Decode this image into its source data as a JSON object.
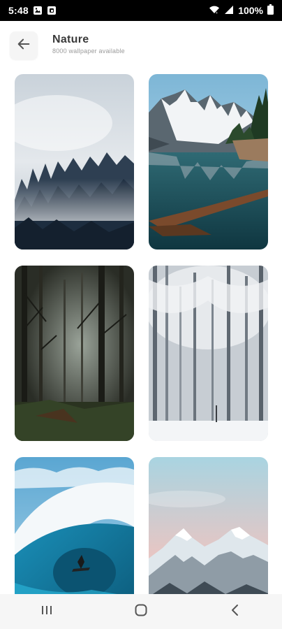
{
  "status_bar": {
    "time": "5:48",
    "battery": "100%",
    "icons": [
      "image-icon",
      "app-notification-icon",
      "wifi-icon",
      "signal-icon",
      "battery-icon"
    ]
  },
  "header": {
    "title": "Nature",
    "subtitle": "8000 wallpaper available",
    "back_icon": "arrow-left-icon"
  },
  "wallpapers": [
    {
      "subject": "misty-forest"
    },
    {
      "subject": "mountain-lake"
    },
    {
      "subject": "dark-forest"
    },
    {
      "subject": "snowy-forest"
    },
    {
      "subject": "ocean-wave-surfer"
    },
    {
      "subject": "snowy-mountains"
    }
  ],
  "nav_bar": {
    "icons": [
      "recent-apps-icon",
      "home-icon",
      "back-nav-icon"
    ]
  },
  "colors": {
    "status_bar_bg": "#000000",
    "header_title": "#3a3a3a",
    "header_subtitle": "#9a9a9a",
    "nav_bar_bg": "#f6f6f6"
  }
}
